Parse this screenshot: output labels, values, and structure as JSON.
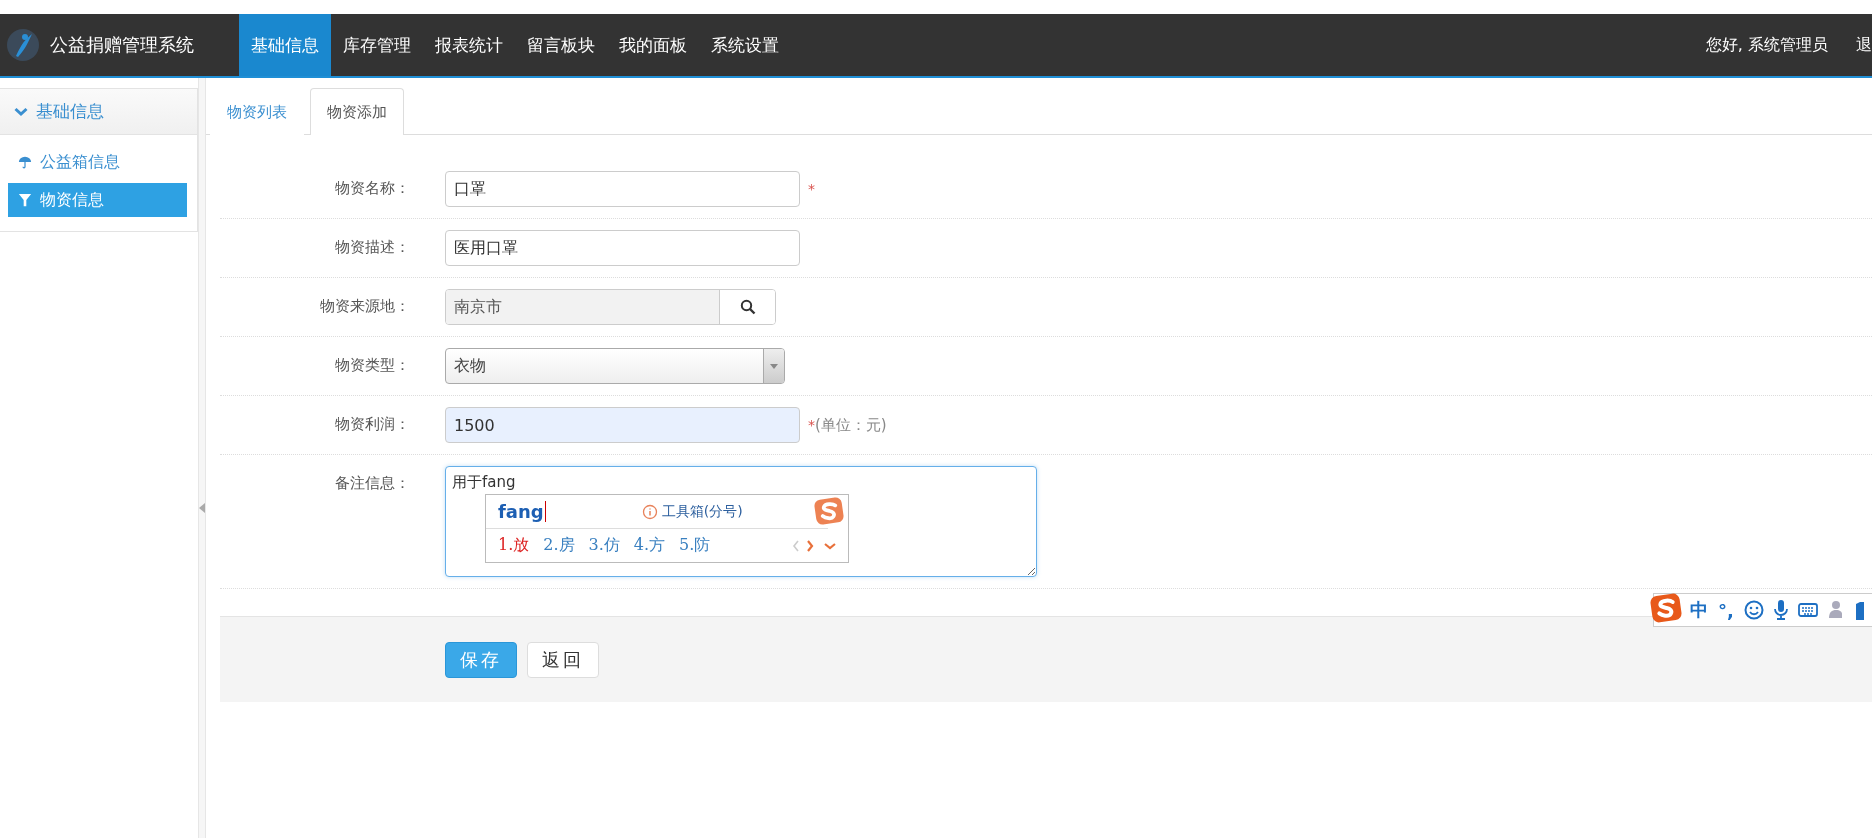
{
  "header": {
    "title": "公益捐赠管理系统",
    "nav": [
      {
        "label": "基础信息",
        "selected": true
      },
      {
        "label": "库存管理",
        "selected": false
      },
      {
        "label": "报表统计",
        "selected": false
      },
      {
        "label": "留言板块",
        "selected": false
      },
      {
        "label": "我的面板",
        "selected": false
      },
      {
        "label": "系统设置",
        "selected": false
      }
    ],
    "greeting": "您好, 系统管理员",
    "logout": "退"
  },
  "sidebar": {
    "title": "基础信息",
    "expanded": true,
    "items": [
      {
        "label": "公益箱信息",
        "kind": "umbrella",
        "selected": false
      },
      {
        "label": "物资信息",
        "kind": "filter",
        "selected": true
      }
    ]
  },
  "tabs": [
    {
      "label": "物资列表",
      "selected": false
    },
    {
      "label": "物资添加",
      "selected": true
    }
  ],
  "form": {
    "fields": [
      {
        "kind": "text",
        "label": "物资名称：",
        "value": "口罩",
        "required_mark": "*"
      },
      {
        "kind": "text",
        "label": "物资描述：",
        "value": "医用口罩"
      },
      {
        "kind": "lookup",
        "label": "物资来源地：",
        "value": "南京市"
      },
      {
        "kind": "select",
        "label": "物资类型：",
        "value": "衣物"
      },
      {
        "kind": "text",
        "label": "物资利润：",
        "value": "1500",
        "autofilled": true,
        "required_mark": "*",
        "hint": "(单位：元)"
      },
      {
        "kind": "textarea",
        "label": "备注信息：",
        "value": "用于fang"
      }
    ],
    "buttons": [
      {
        "label": "保存",
        "primary": true
      },
      {
        "label": "返回",
        "primary": false
      }
    ]
  },
  "ime": {
    "composition": "fang",
    "tip": "工具箱(分号)",
    "candidates": [
      {
        "label": "1.放",
        "selected": true
      },
      {
        "label": "2.房",
        "selected": false
      },
      {
        "label": "3.仿",
        "selected": false
      },
      {
        "label": "4.方",
        "selected": false
      },
      {
        "label": "5.防",
        "selected": false
      }
    ]
  },
  "ime_toolbar": {
    "mode": "中",
    "punctuation": "°,"
  }
}
